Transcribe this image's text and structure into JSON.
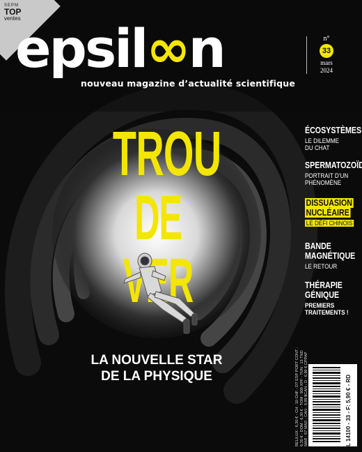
{
  "badge": {
    "small": "SEPM",
    "top": "TOP",
    "ventes": "ventes"
  },
  "masthead": {
    "logo_prefix": "epsil",
    "logo_symbol": "∞",
    "logo_suffix": "n",
    "tagline": "nouveau magazine d’actualité scientifique"
  },
  "issue": {
    "label": "n°",
    "number": "33",
    "month": "mars",
    "year": "2024"
  },
  "headline": {
    "line1": "TROU",
    "line2": "DE VER"
  },
  "subheadline": {
    "line1": "LA NOUVELLE STAR",
    "line2": "DE LA PHYSIQUE"
  },
  "sidebar": [
    {
      "title": "ÉCOSYSTÈMES",
      "sub1": "LE DILEMME",
      "sub2": "DU CHAT"
    },
    {
      "title": "SPERMATOZOÏDE",
      "sub1": "PORTRAIT D’UN",
      "sub2": "PHÉNOMÈNE"
    },
    {
      "title1": "DISSUASION",
      "title2": "NUCLÉAIRE",
      "sub1": "LE DÉFI CHINOIS"
    },
    {
      "title1": "BANDE",
      "title2": "MAGNÉTIQUE",
      "sub1": "LE RETOUR"
    },
    {
      "title1": "THÉRAPIE",
      "title2": "GÉNIQUE",
      "sub1": "PREMIERS",
      "sub2": "TRAITEMENTS !"
    }
  ],
  "price": {
    "line1": "BEL/LUX : 6,30 € - CH : 10 CHF - DT ESP PORT CONT :",
    "line2": "6,30 € - DOM : 6,30 € - TOM : 900 XPF - TUN : 13 TND",
    "line3": "MAR : 67 MAD - CAN : 9,99 $CAN - D : 6,90 € CPPAP",
    "code": "L 14100 - 33 - F: 5,90 € - RD"
  },
  "colors": {
    "accent": "#f3e600",
    "background": "#0b0b0b",
    "text": "#ffffff"
  }
}
